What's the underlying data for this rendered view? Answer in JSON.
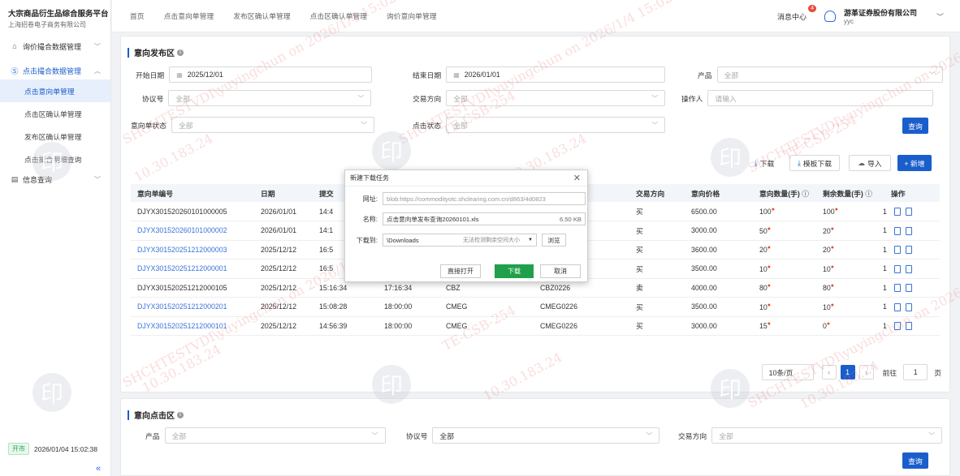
{
  "sidebar": {
    "brand_title": "大宗商品衍生品综合服务平台",
    "brand_sub": "上海招卷电子商务有限公司",
    "groups": [
      {
        "label": "询价撮合数据管理",
        "icon": "building-icon"
      },
      {
        "label": "点击撮合数据管理",
        "icon": "circle-s-icon"
      },
      {
        "label": "信息查询",
        "icon": "list-icon"
      }
    ],
    "items": [
      "点击意向单管理",
      "点击区确认单管理",
      "发布区确认单管理",
      "点击撮合明细查询"
    ],
    "status_badge": "开市",
    "datetime": "2026/01/04 15:02:38",
    "collapse": "«"
  },
  "topbar": {
    "tabs": [
      "首页",
      "点击意向单管理",
      "发布区确认单管理",
      "点击区确认单管理",
      "询价意向单管理"
    ],
    "msg_center": "消息中心",
    "msg_count": "4",
    "company": "游革证券股份有限公司",
    "user": "yyc"
  },
  "publish": {
    "title": "意向发布区",
    "filters": {
      "start_label": "开始日期",
      "start_value": "2025/12/01",
      "end_label": "结束日期",
      "end_value": "2026/01/01",
      "product_label": "产品",
      "product_ph": "全部",
      "protocol_label": "协议号",
      "protocol_ph": "全部",
      "direction_label": "交易方向",
      "direction_ph": "全部",
      "operator_label": "操作人",
      "operator_ph": "请输入",
      "status_label": "意向单状态",
      "status_ph": "全部",
      "click_label": "点击状态",
      "click_ph": "全部"
    },
    "buttons": {
      "query": "查询",
      "download": "下载",
      "template": "模板下载",
      "import": "导入",
      "add": "+ 新增"
    },
    "columns": [
      "意向单编号",
      "日期",
      "提交",
      "",
      "",
      "",
      "交易方向",
      "意向价格",
      "意向数量(手)",
      "剩余数量(手)",
      "",
      "操作"
    ],
    "rows": [
      {
        "id": "DJYX301520260101000005",
        "date": "2026/01/01",
        "t1": "14:4",
        "t2": "",
        "code": "",
        "contract": "",
        "dir": "买",
        "price": "6500.00",
        "qty": "100",
        "rest": "100",
        "x": "1",
        "link": false
      },
      {
        "id": "DJYX301520260101000002",
        "date": "2026/01/01",
        "t1": "14:1",
        "t2": "",
        "code": "",
        "contract": "",
        "dir": "买",
        "price": "3000.00",
        "qty": "50",
        "rest": "20",
        "x": "1",
        "link": true
      },
      {
        "id": "DJYX301520251212000003",
        "date": "2025/12/12",
        "t1": "16:5",
        "t2": "",
        "code": "",
        "contract": "",
        "dir": "买",
        "price": "3600.00",
        "qty": "20",
        "rest": "20",
        "x": "1",
        "link": true
      },
      {
        "id": "DJYX301520251212000001",
        "date": "2025/12/12",
        "t1": "16:5",
        "t2": "",
        "code": "",
        "contract": "",
        "dir": "买",
        "price": "3500.00",
        "qty": "10",
        "rest": "10",
        "x": "1",
        "link": true
      },
      {
        "id": "DJYX301520251212000105",
        "date": "2025/12/12",
        "t1": "15:16:34",
        "t2": "17:16:34",
        "code": "CBZ",
        "contract": "CBZ0226",
        "dir": "卖",
        "price": "4000.00",
        "qty": "80",
        "rest": "80",
        "x": "1",
        "link": false
      },
      {
        "id": "DJYX301520251212000201",
        "date": "2025/12/12",
        "t1": "15:08:28",
        "t2": "18:00:00",
        "code": "CMEG",
        "contract": "CMEG0226",
        "dir": "买",
        "price": "3500.00",
        "qty": "10",
        "rest": "10",
        "x": "1",
        "link": true
      },
      {
        "id": "DJYX301520251212000101",
        "date": "2025/12/12",
        "t1": "14:56:39",
        "t2": "18:00:00",
        "code": "CMEG",
        "contract": "CMEG0226",
        "dir": "买",
        "price": "3000.00",
        "qty": "15",
        "rest": "0",
        "x": "1",
        "link": true
      }
    ],
    "pager": {
      "size": "10条/页",
      "prev": "‹",
      "current": "1",
      "next": "›",
      "goto": "前往",
      "page": "1",
      "unit": "页"
    }
  },
  "click": {
    "title": "意向点击区",
    "product_label": "产品",
    "product_ph": "全部",
    "protocol_label": "协议号",
    "protocol_value": "全部",
    "direction_label": "交易方向",
    "direction_ph": "全部",
    "query": "查询"
  },
  "dialog": {
    "title": "新建下载任务",
    "url_label": "网址:",
    "url_value": "blob:https://commodityotc.shclearing.com.cn/d863/4d0823",
    "name_label": "名称:",
    "name_value": "点击意向单发布查询20260101.xls",
    "size": "6.50 KB",
    "dest_label": "下载到:",
    "dest_value": "\\Downloads",
    "dest_note": "无法检测剩余空间大小",
    "browse": "浏览",
    "open": "直接打开",
    "download": "下载",
    "cancel": "取消"
  },
  "watermarks": [
    "SHCHTESTVDI\\yuyingchun on 2026/1/4 15:02",
    "TE-CSB-254",
    "10.30.183.24"
  ],
  "stamp_char": "印",
  "colors": {
    "primary": "#1a5ecc",
    "link": "#3a73d9",
    "green": "#20a04a",
    "danger": "#e84a3b"
  }
}
